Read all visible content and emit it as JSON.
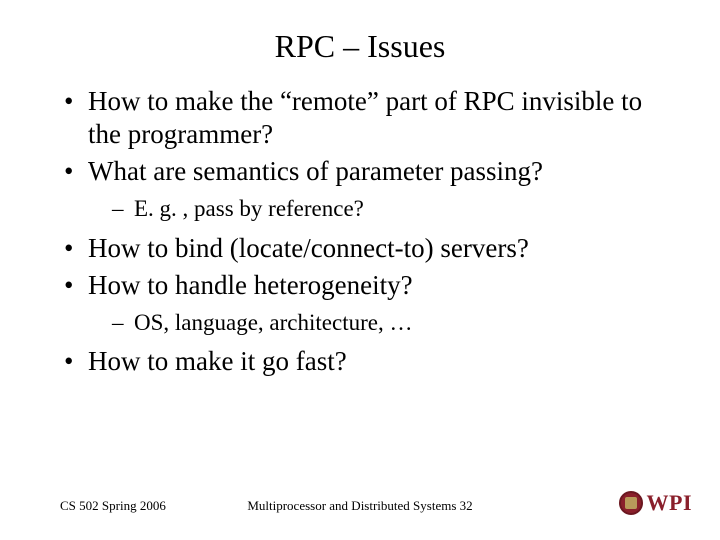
{
  "title": "RPC – Issues",
  "bullets": {
    "b1": "How to make the “remote” part of RPC invisible to the programmer?",
    "b2": "What are semantics of parameter passing?",
    "b2s1": "E. g. , pass by reference?",
    "b3": "How to bind (locate/connect-to) servers?",
    "b4": "How to handle heterogeneity?",
    "b4s1": "OS, language, architecture, …",
    "b5": "How to make it go fast?"
  },
  "footer": {
    "left": "CS 502 Spring 2006",
    "center": "Multiprocessor and Distributed Systems  32"
  },
  "logo": {
    "text": "WPI"
  }
}
